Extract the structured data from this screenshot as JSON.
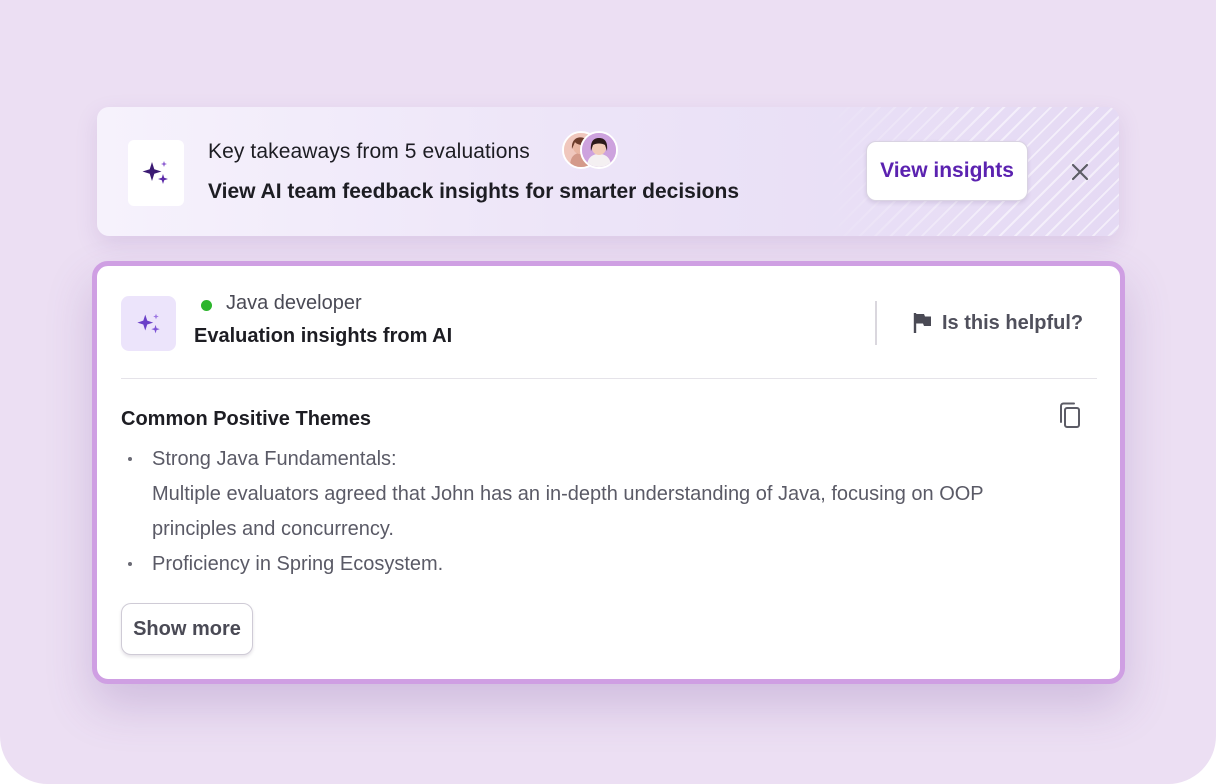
{
  "colors": {
    "page_background": "#ecdff3",
    "accent_purple": "#5b22b0",
    "card_border": "#cf9fe3",
    "status_green": "#2cb52c"
  },
  "banner": {
    "icon": "sparkles-icon",
    "title": "Key takeaways from 5 evaluations",
    "subtitle": "View AI team feedback insights for smarter decisions",
    "avatars": [
      "avatar-evaluator-1",
      "avatar-evaluator-2"
    ],
    "view_button_label": "View insights",
    "close_icon": "close-icon"
  },
  "card": {
    "icon": "sparkles-icon",
    "role": "Java developer",
    "status": "online",
    "title": "Evaluation insights from AI",
    "helpful_icon": "flag-icon",
    "helpful_label": "Is this helpful?",
    "copy_icon": "copy-icon",
    "section_title": "Common Positive Themes",
    "items": [
      {
        "heading": "Strong Java Fundamentals:",
        "line1": "Multiple evaluators agreed that John has an in-depth understanding of Java, focusing on OOP",
        "line2": "principles and concurrency."
      },
      {
        "heading": "Proficiency in Spring Ecosystem."
      }
    ],
    "show_more_label": "Show more"
  }
}
